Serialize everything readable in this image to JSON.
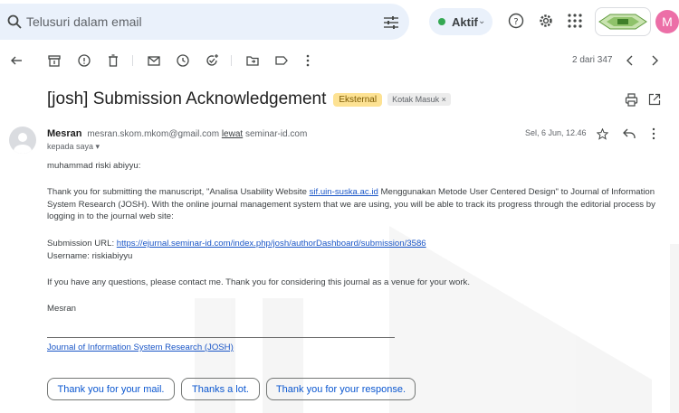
{
  "search": {
    "placeholder": "Telusuri dalam email"
  },
  "status": {
    "label": "Aktif"
  },
  "account": {
    "avatar_letter": "M"
  },
  "toolbar": {
    "page_count": "2 dari 347"
  },
  "email": {
    "subject": "[josh] Submission Acknowledgement",
    "labels": {
      "external": "Eksternal",
      "inbox": "Kotak Masuk ×"
    },
    "sender_name": "Mesran",
    "sender_email": "mesran.skom.mkom@gmail.com",
    "via_word": "lewat",
    "via_domain": "seminar-id.com",
    "recipient": "kepada saya ▾",
    "date": "Sel, 6 Jun, 12.46",
    "greeting": "muhammad riski abiyyu:",
    "p1_a": "Thank you for submitting the manuscript, \"Analisa Usability Website ",
    "p1_link": "sif.uin-suska.ac.id",
    "p1_b": " Menggunakan Metode User Centered Design\" to Journal of Information",
    "p1_line2": "System Research (JOSH). With the online journal management system that we are using, you will be able to track its progress through the editorial process by",
    "p1_line3": "logging in to the journal web site:",
    "submission_label": "Submission URL: ",
    "submission_url": "https://ejurnal.seminar-id.com/index.php/josh/authorDashboard/submission/3586",
    "username_line": "Username: riskiabiyyu",
    "p3": "If you have any questions, please contact me. Thank you for considering this journal as a venue for your work.",
    "signoff": "Mesran",
    "journal_link": "Journal of Information System Research (JOSH)"
  },
  "smart_replies": [
    "Thank you for your mail.",
    "Thanks a lot.",
    "Thank you for your response."
  ],
  "colors": {
    "accent": "#0b57d0",
    "link": "#1a56c7",
    "avatar": "#ec6fa7",
    "badge": "#fde293",
    "active": "#34a853"
  }
}
